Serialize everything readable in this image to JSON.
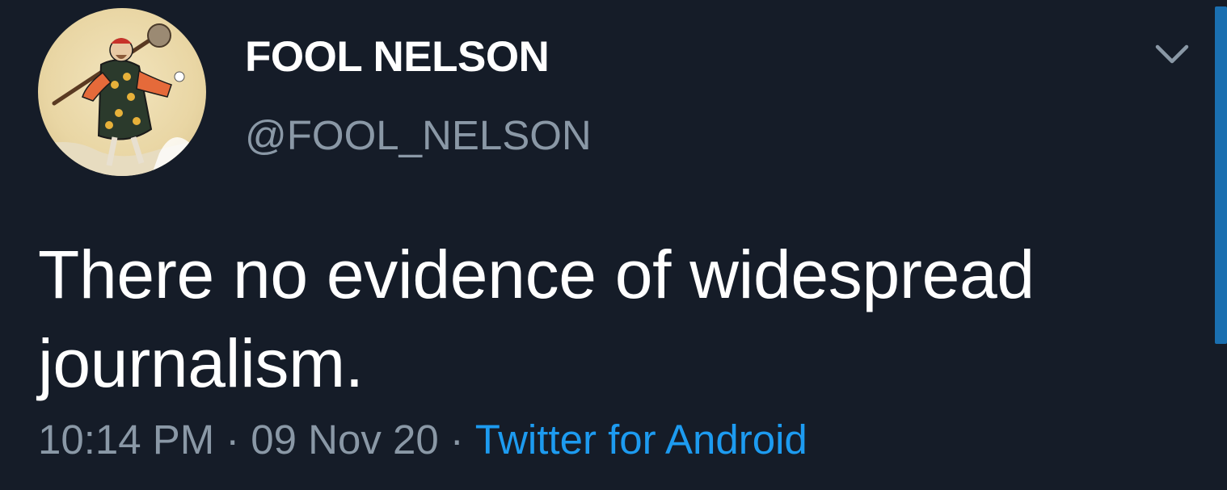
{
  "tweet": {
    "author": {
      "display_name": "FOOL NELSON",
      "handle": "@FOOL_NELSON",
      "avatar_icon": "fool-tarot-avatar"
    },
    "menu_icon": "chevron-down-icon",
    "text_line1": "There no evidence of widespread",
    "text_line2": "journalism.",
    "time": "10:14 PM",
    "separator": "·",
    "date": "09 Nov 20",
    "source": "Twitter for Android"
  },
  "colors": {
    "background": "#151c28",
    "text": "#ffffff",
    "muted": "#8a98a6",
    "link": "#1d9bf0",
    "scrollbar": "#1a6fb0"
  }
}
